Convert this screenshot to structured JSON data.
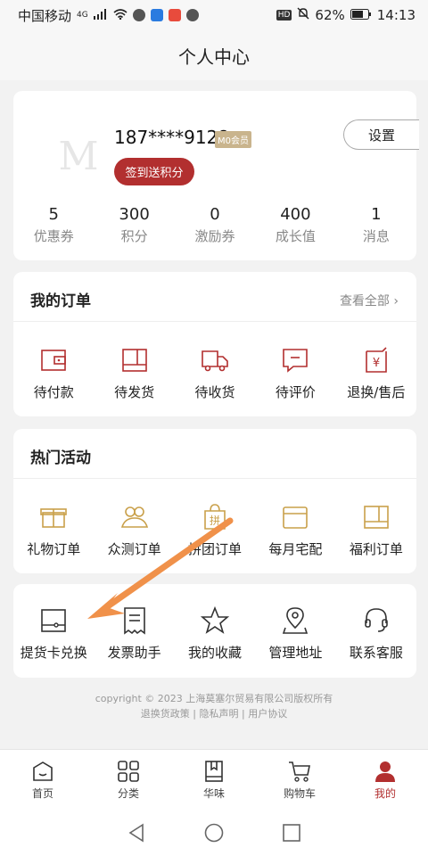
{
  "status": {
    "carrier": "中国移动",
    "network": "4G",
    "battery": "62%",
    "time": "14:13"
  },
  "header": {
    "title": "个人中心"
  },
  "profile": {
    "avatar_letter": "M",
    "phone": "187****9128",
    "member_level": "M0会员",
    "signin_label": "签到送积分",
    "settings_label": "设置",
    "stats": [
      {
        "value": "5",
        "label": "优惠券"
      },
      {
        "value": "300",
        "label": "积分"
      },
      {
        "value": "0",
        "label": "激励券"
      },
      {
        "value": "400",
        "label": "成长值"
      },
      {
        "value": "1",
        "label": "消息"
      }
    ]
  },
  "orders": {
    "title": "我的订单",
    "more": "查看全部",
    "items": [
      {
        "label": "待付款",
        "icon": "wallet-icon"
      },
      {
        "label": "待发货",
        "icon": "box-icon"
      },
      {
        "label": "待收货",
        "icon": "truck-icon"
      },
      {
        "label": "待评价",
        "icon": "comment-icon"
      },
      {
        "label": "退换/售后",
        "icon": "refund-icon"
      }
    ]
  },
  "activities": {
    "title": "热门活动",
    "items": [
      {
        "label": "礼物订单",
        "icon": "gift-icon"
      },
      {
        "label": "众测订单",
        "icon": "group-icon"
      },
      {
        "label": "拼团订单",
        "icon": "bag-icon",
        "badge": "拼"
      },
      {
        "label": "每月宅配",
        "icon": "calendar-icon"
      },
      {
        "label": "福利订单",
        "icon": "welfare-icon"
      }
    ]
  },
  "tools": {
    "items": [
      {
        "label": "提货卡兑换",
        "icon": "card-icon"
      },
      {
        "label": "发票助手",
        "icon": "invoice-icon"
      },
      {
        "label": "我的收藏",
        "icon": "star-icon"
      },
      {
        "label": "管理地址",
        "icon": "location-icon"
      },
      {
        "label": "联系客服",
        "icon": "headset-icon"
      }
    ]
  },
  "footer": {
    "copyright": "copyright © 2023 上海莫塞尔贸易有限公司版权所有",
    "links": "退换货政策 | 隐私声明 | 用户协议"
  },
  "tabbar": [
    {
      "label": "首页",
      "icon": "home-icon"
    },
    {
      "label": "分类",
      "icon": "category-icon"
    },
    {
      "label": "华味",
      "icon": "book-icon"
    },
    {
      "label": "购物车",
      "icon": "cart-icon"
    },
    {
      "label": "我的",
      "icon": "user-icon",
      "active": true
    }
  ],
  "colors": {
    "accent": "#b22f2f",
    "gold": "#c9a04a",
    "arrow": "#f0914a"
  }
}
